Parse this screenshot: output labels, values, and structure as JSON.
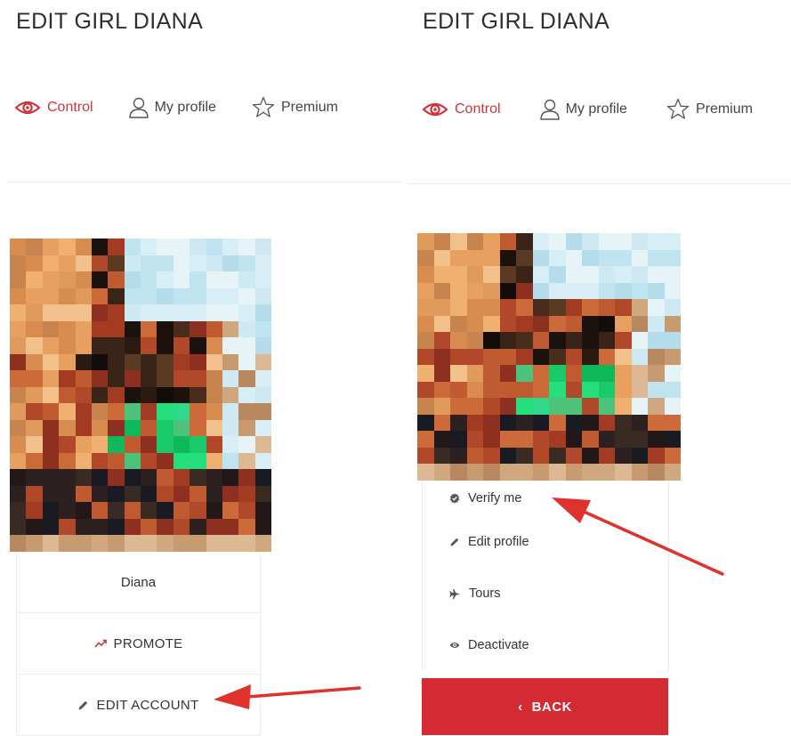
{
  "left_panel": {
    "title": "EDIT GIRL DIANA",
    "tabs": [
      {
        "label": "Control",
        "icon": "eye-icon",
        "active": true
      },
      {
        "label": "My profile",
        "icon": "user-icon",
        "active": false
      },
      {
        "label": "Premium",
        "icon": "star-icon",
        "active": false
      }
    ],
    "profile_name": "Diana",
    "promote_label": "PROMOTE",
    "edit_account_label": "EDIT ACCOUNT"
  },
  "right_panel": {
    "title": "EDIT GIRL DIANA",
    "tabs": [
      {
        "label": "Control",
        "icon": "eye-icon",
        "active": true
      },
      {
        "label": "My profile",
        "icon": "user-icon",
        "active": false
      },
      {
        "label": "Premium",
        "icon": "star-icon",
        "active": false
      }
    ],
    "menu": [
      {
        "label": "Verify me",
        "icon": "verified-badge-icon"
      },
      {
        "label": "Edit profile",
        "icon": "pencil-icon"
      },
      {
        "label": "Tours",
        "icon": "airplane-icon"
      },
      {
        "label": "Deactivate",
        "icon": "eye-icon"
      }
    ],
    "back_label": "BACK"
  },
  "colors": {
    "accent": "#d0343a",
    "button_red": "#d32a33",
    "annotation_arrow": "#e0322c",
    "text": "#333333",
    "divider": "#ececec"
  },
  "photo": {
    "description_icon": "pixelated-profile-photo"
  }
}
